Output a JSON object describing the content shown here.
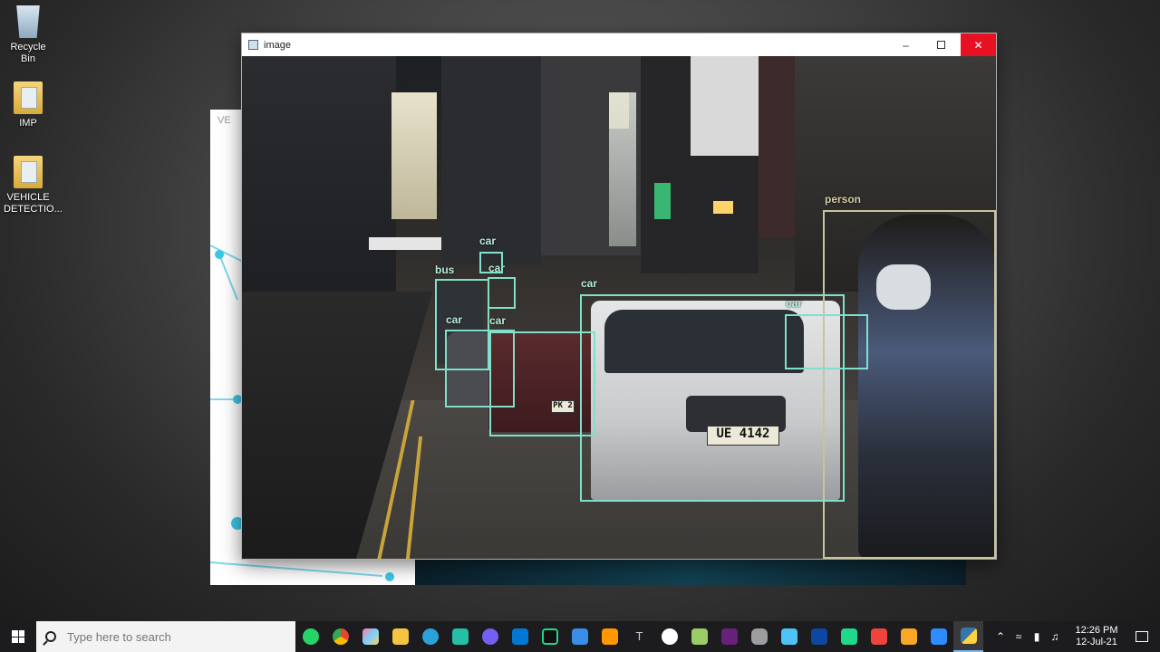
{
  "desktop": {
    "icons": [
      {
        "label": "Recycle Bin"
      },
      {
        "label": "IMP"
      },
      {
        "label": "VEHICLE DETECTIO..."
      }
    ]
  },
  "back_window": {
    "title_fragment": "VE"
  },
  "image_window": {
    "title": "image",
    "plate_text": "UE 4142",
    "taxi_plate": "PK 2",
    "detections": [
      {
        "label": "person"
      },
      {
        "label": "car"
      },
      {
        "label": "car"
      },
      {
        "label": "bus"
      },
      {
        "label": "car"
      },
      {
        "label": "car"
      },
      {
        "label": "car"
      },
      {
        "label": "car"
      }
    ]
  },
  "taskbar": {
    "search_placeholder": "Type here to search",
    "apps": [
      "whatsapp",
      "chrome",
      "paint",
      "file-explorer",
      "telegram",
      "vscode-insiders",
      "viber",
      "vscode",
      "pycharm",
      "window",
      "sublime",
      "typora",
      "github",
      "notepad-plus",
      "visual-studio",
      "database",
      "screen",
      "terminal",
      "pycharm-ce",
      "anydesk",
      "notes",
      "zoom",
      "python"
    ],
    "time": "12:26 PM",
    "date": "12-Jul-21"
  },
  "colors": {
    "bbox": "#7fe0cc",
    "bbox_person": "#c9c49a",
    "close_button": "#e81123",
    "taskbar": "#1c1c1e"
  }
}
